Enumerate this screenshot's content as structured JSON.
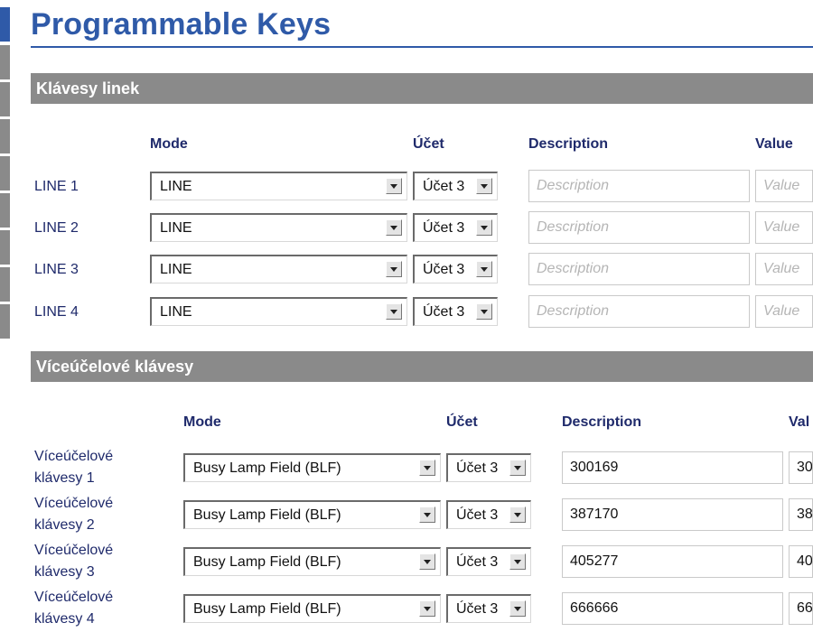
{
  "page": {
    "title": "Programmable Keys"
  },
  "line_keys": {
    "section_title": "Klávesy linek",
    "headers": {
      "mode": "Mode",
      "account": "Účet",
      "description": "Description",
      "value": "Value"
    },
    "rows": [
      {
        "label": "LINE 1",
        "mode": "LINE",
        "account": "Účet 3",
        "description": "",
        "value": ""
      },
      {
        "label": "LINE 2",
        "mode": "LINE",
        "account": "Účet 3",
        "description": "",
        "value": ""
      },
      {
        "label": "LINE 3",
        "mode": "LINE",
        "account": "Účet 3",
        "description": "",
        "value": ""
      },
      {
        "label": "LINE 4",
        "mode": "LINE",
        "account": "Účet 3",
        "description": "",
        "value": ""
      }
    ],
    "placeholders": {
      "description": "Description",
      "value": "Value"
    }
  },
  "multi_keys": {
    "section_title": "Víceúčelové klávesy",
    "headers": {
      "mode": "Mode",
      "account": "Účet",
      "description": "Description",
      "value": "Val"
    },
    "rows": [
      {
        "label_line1": "Víceúčelové",
        "label_line2": "klávesy 1",
        "mode": "Busy Lamp Field (BLF)",
        "account": "Účet 3",
        "description": "300169",
        "value": "30"
      },
      {
        "label_line1": "Víceúčelové",
        "label_line2": "klávesy 2",
        "mode": "Busy Lamp Field (BLF)",
        "account": "Účet 3",
        "description": "387170",
        "value": "38"
      },
      {
        "label_line1": "Víceúčelové",
        "label_line2": "klávesy 3",
        "mode": "Busy Lamp Field (BLF)",
        "account": "Účet 3",
        "description": "405277",
        "value": "40"
      },
      {
        "label_line1": "Víceúčelové",
        "label_line2": "klávesy 4",
        "mode": "Busy Lamp Field (BLF)",
        "account": "Účet 3",
        "description": "666666",
        "value": "66"
      }
    ]
  },
  "icons": {
    "dropdown": "chevron-down-icon"
  },
  "colors": {
    "accent": "#2f5aa8",
    "section_bar": "#8a8a8a",
    "label_text": "#1f2a6b"
  }
}
